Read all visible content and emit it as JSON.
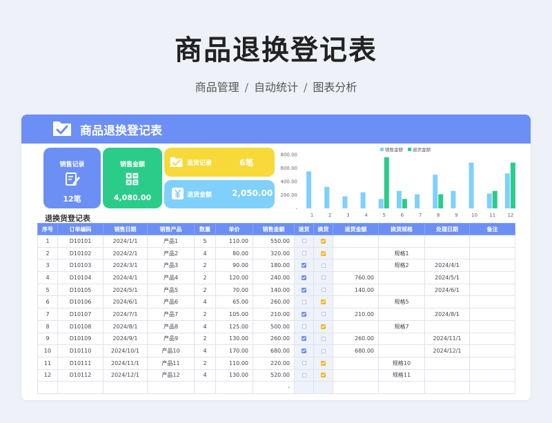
{
  "page": {
    "title": "商品退换登记表",
    "subtitle_parts": [
      "商品管理",
      "自动统计",
      "图表分析"
    ],
    "separator": "/"
  },
  "card": {
    "header_title": "商品退换登记表",
    "header_icon": "folder-check-icon"
  },
  "colors": {
    "primary": "#6b8ff5",
    "green": "#2bcc8a",
    "yellow": "#f7d93a",
    "light_blue": "#7fd0fb",
    "bar_blue": "#7fd0fb",
    "bar_green": "#2bcc8a"
  },
  "tiles": {
    "sales_count": {
      "label": "销售记录",
      "value": "12笔",
      "icon": "document-pen-icon"
    },
    "sales_amount": {
      "label": "销售金额",
      "value": "4,080.00",
      "icon": "calculator-icon"
    },
    "return_count": {
      "label": "退货记录",
      "value": "6笔",
      "icon": "folder-check-icon"
    },
    "return_amount": {
      "label": "退货金额",
      "value": "2,050.00",
      "icon": "yen-icon"
    }
  },
  "chart_data": {
    "type": "bar",
    "categories": [
      "1",
      "2",
      "3",
      "4",
      "5",
      "6",
      "7",
      "8",
      "9",
      "10",
      "11",
      "12"
    ],
    "series": [
      {
        "name": "销售金额",
        "values": [
          550,
          320,
          180,
          240,
          140,
          260,
          210,
          500,
          260,
          680,
          220,
          520
        ]
      },
      {
        "name": "退货金额",
        "values": [
          0,
          0,
          0,
          0,
          760,
          140,
          0,
          210,
          0,
          0,
          260,
          680
        ]
      }
    ],
    "y_ticks": [
      "800.00",
      "600.00",
      "400.00",
      "200.00",
      "-"
    ],
    "ylim": [
      0,
      800
    ],
    "legend_position": "top-right",
    "grid": false
  },
  "table": {
    "caption": "退换货登记表",
    "headers": [
      "序号",
      "订单编码",
      "销售日期",
      "销售产品",
      "数量",
      "单价",
      "销售金额",
      "退货",
      "换货",
      "退货金额",
      "换货规格",
      "处理日期",
      "备注"
    ],
    "rows": [
      [
        "1",
        "D10101",
        "2024/1/1",
        "产品1",
        "5",
        "110.00",
        "550.00",
        "",
        "",
        "",
        "",
        "",
        ""
      ],
      [
        "2",
        "D10102",
        "2024/2/1",
        "产品2",
        "4",
        "80.00",
        "320.00",
        "",
        "",
        "",
        "规格1",
        "",
        ""
      ],
      [
        "3",
        "D10103",
        "2024/3/1",
        "产品3",
        "2",
        "90.00",
        "180.00",
        "",
        "",
        "",
        "规格2",
        "2024/4/1",
        ""
      ],
      [
        "4",
        "D10104",
        "2024/4/1",
        "产品4",
        "2",
        "120.00",
        "240.00",
        "",
        "",
        "760.00",
        "",
        "2024/5/1",
        ""
      ],
      [
        "5",
        "D10105",
        "2024/5/1",
        "产品5",
        "2",
        "70.00",
        "140.00",
        "",
        "",
        "140.00",
        "",
        "2024/6/1",
        ""
      ],
      [
        "6",
        "D10106",
        "2024/6/1",
        "产品6",
        "4",
        "65.00",
        "260.00",
        "",
        "",
        "",
        "规格5",
        "",
        ""
      ],
      [
        "7",
        "D10107",
        "2024/7/1",
        "产品7",
        "2",
        "105.00",
        "210.00",
        "",
        "",
        "210.00",
        "",
        "2024/8/1",
        ""
      ],
      [
        "8",
        "D10108",
        "2024/8/1",
        "产品8",
        "4",
        "125.00",
        "500.00",
        "",
        "",
        "",
        "规格7",
        "",
        ""
      ],
      [
        "9",
        "D10109",
        "2024/9/1",
        "产品9",
        "2",
        "130.00",
        "260.00",
        "",
        "",
        "260.00",
        "",
        "2024/11/1",
        ""
      ],
      [
        "10",
        "D10110",
        "2024/10/1",
        "产品10",
        "4",
        "170.00",
        "680.00",
        "",
        "",
        "680.00",
        "",
        "2024/12/1",
        ""
      ],
      [
        "11",
        "D10111",
        "2024/11/1",
        "产品11",
        "2",
        "110.00",
        "220.00",
        "",
        "",
        "",
        "规格10",
        "",
        ""
      ],
      [
        "12",
        "D10112",
        "2024/12/1",
        "产品12",
        "4",
        "130.00",
        "520.00",
        "",
        "",
        "",
        "规格11",
        "",
        ""
      ],
      [
        "",
        "",
        "",
        "",
        "",
        "",
        "-",
        "",
        "",
        "",
        "",
        "",
        ""
      ]
    ],
    "return_checked": [
      false,
      false,
      true,
      true,
      true,
      false,
      true,
      false,
      true,
      true,
      false,
      false,
      false
    ],
    "exchange_checked": [
      true,
      true,
      false,
      false,
      false,
      true,
      false,
      true,
      false,
      false,
      true,
      true,
      false
    ],
    "checkbox_rows": 12
  }
}
